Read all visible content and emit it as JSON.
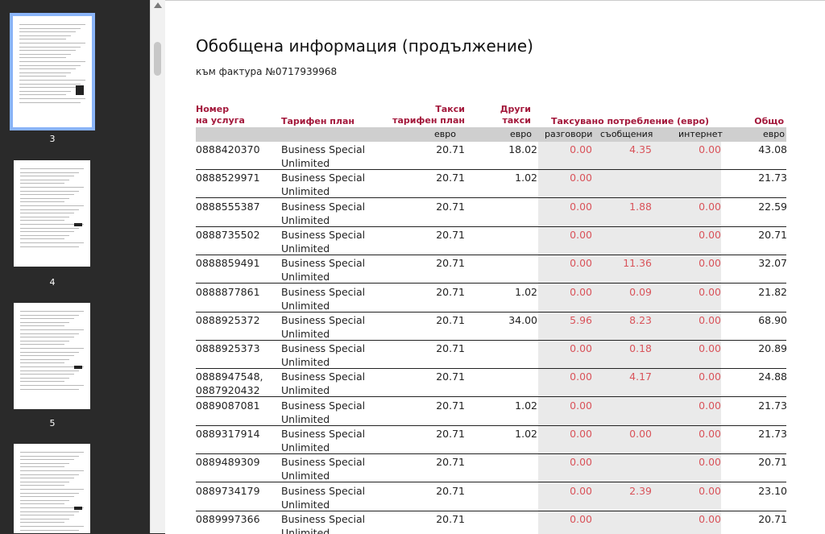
{
  "sidebar": {
    "thumbnails": [
      {
        "page_label": "3"
      },
      {
        "page_label": "4"
      },
      {
        "page_label": "5"
      },
      {
        "page_label": ""
      }
    ]
  },
  "document": {
    "title": "Обобщена информация (продължение)",
    "subtitle": "към фактура №0717939968",
    "headers": {
      "service_number": "Номер\nна услуга",
      "tariff_plan": "Тарифен план",
      "tariff_fees": "Такси\nтарифен план",
      "other_fees": "Други\nтакси",
      "charged_usage": "Таксувано потребление (евро)",
      "total": "Общо"
    },
    "units": {
      "tariff_fees": "евро",
      "other_fees": "евро",
      "calls": "разговори",
      "messages": "съобщения",
      "internet": "интернет",
      "total": "евро"
    },
    "rows": [
      {
        "number": "0888420370",
        "plan": "Business Special\nUnlimited",
        "tariff": "20.71",
        "other": "18.02",
        "calls": "0.00",
        "messages": "4.35",
        "internet": "0.00",
        "total": "43.08"
      },
      {
        "number": "0888529971",
        "plan": "Business Special\nUnlimited",
        "tariff": "20.71",
        "other": "1.02",
        "calls": "0.00",
        "messages": "",
        "internet": "",
        "total": "21.73"
      },
      {
        "number": "0888555387",
        "plan": "Business Special\nUnlimited",
        "tariff": "20.71",
        "other": "",
        "calls": "0.00",
        "messages": "1.88",
        "internet": "0.00",
        "total": "22.59"
      },
      {
        "number": "0888735502",
        "plan": "Business Special\nUnlimited",
        "tariff": "20.71",
        "other": "",
        "calls": "0.00",
        "messages": "",
        "internet": "0.00",
        "total": "20.71"
      },
      {
        "number": "0888859491",
        "plan": "Business Special\nUnlimited",
        "tariff": "20.71",
        "other": "",
        "calls": "0.00",
        "messages": "11.36",
        "internet": "0.00",
        "total": "32.07"
      },
      {
        "number": "0888877861",
        "plan": "Business Special\nUnlimited",
        "tariff": "20.71",
        "other": "1.02",
        "calls": "0.00",
        "messages": "0.09",
        "internet": "0.00",
        "total": "21.82"
      },
      {
        "number": "0888925372",
        "plan": "Business Special\nUnlimited",
        "tariff": "20.71",
        "other": "34.00",
        "calls": "5.96",
        "messages": "8.23",
        "internet": "0.00",
        "total": "68.90"
      },
      {
        "number": "0888925373",
        "plan": "Business Special\nUnlimited",
        "tariff": "20.71",
        "other": "",
        "calls": "0.00",
        "messages": "0.18",
        "internet": "0.00",
        "total": "20.89"
      },
      {
        "number": "0888947548,\n0887920432",
        "plan": "Business Special\nUnlimited",
        "tariff": "20.71",
        "other": "",
        "calls": "0.00",
        "messages": "4.17",
        "internet": "0.00",
        "total": "24.88"
      },
      {
        "number": "0889087081",
        "plan": "Business Special\nUnlimited",
        "tariff": "20.71",
        "other": "1.02",
        "calls": "0.00",
        "messages": "",
        "internet": "0.00",
        "total": "21.73"
      },
      {
        "number": "0889317914",
        "plan": "Business Special\nUnlimited",
        "tariff": "20.71",
        "other": "1.02",
        "calls": "0.00",
        "messages": "0.00",
        "internet": "0.00",
        "total": "21.73"
      },
      {
        "number": "0889489309",
        "plan": "Business Special\nUnlimited",
        "tariff": "20.71",
        "other": "",
        "calls": "0.00",
        "messages": "",
        "internet": "0.00",
        "total": "20.71"
      },
      {
        "number": "0889734179",
        "plan": "Business Special\nUnlimited",
        "tariff": "20.71",
        "other": "",
        "calls": "0.00",
        "messages": "2.39",
        "internet": "0.00",
        "total": "23.10"
      },
      {
        "number": "0889997366",
        "plan": "Business Special\nUnlimited",
        "tariff": "20.71",
        "other": "",
        "calls": "0.00",
        "messages": "",
        "internet": "0.00",
        "total": "20.71"
      }
    ]
  },
  "colors": {
    "header_accent": "#a3183b",
    "usage_value": "#d9545b",
    "usage_column_bg": "#eaeaea",
    "selected_thumb_border": "#8ab4f8"
  }
}
